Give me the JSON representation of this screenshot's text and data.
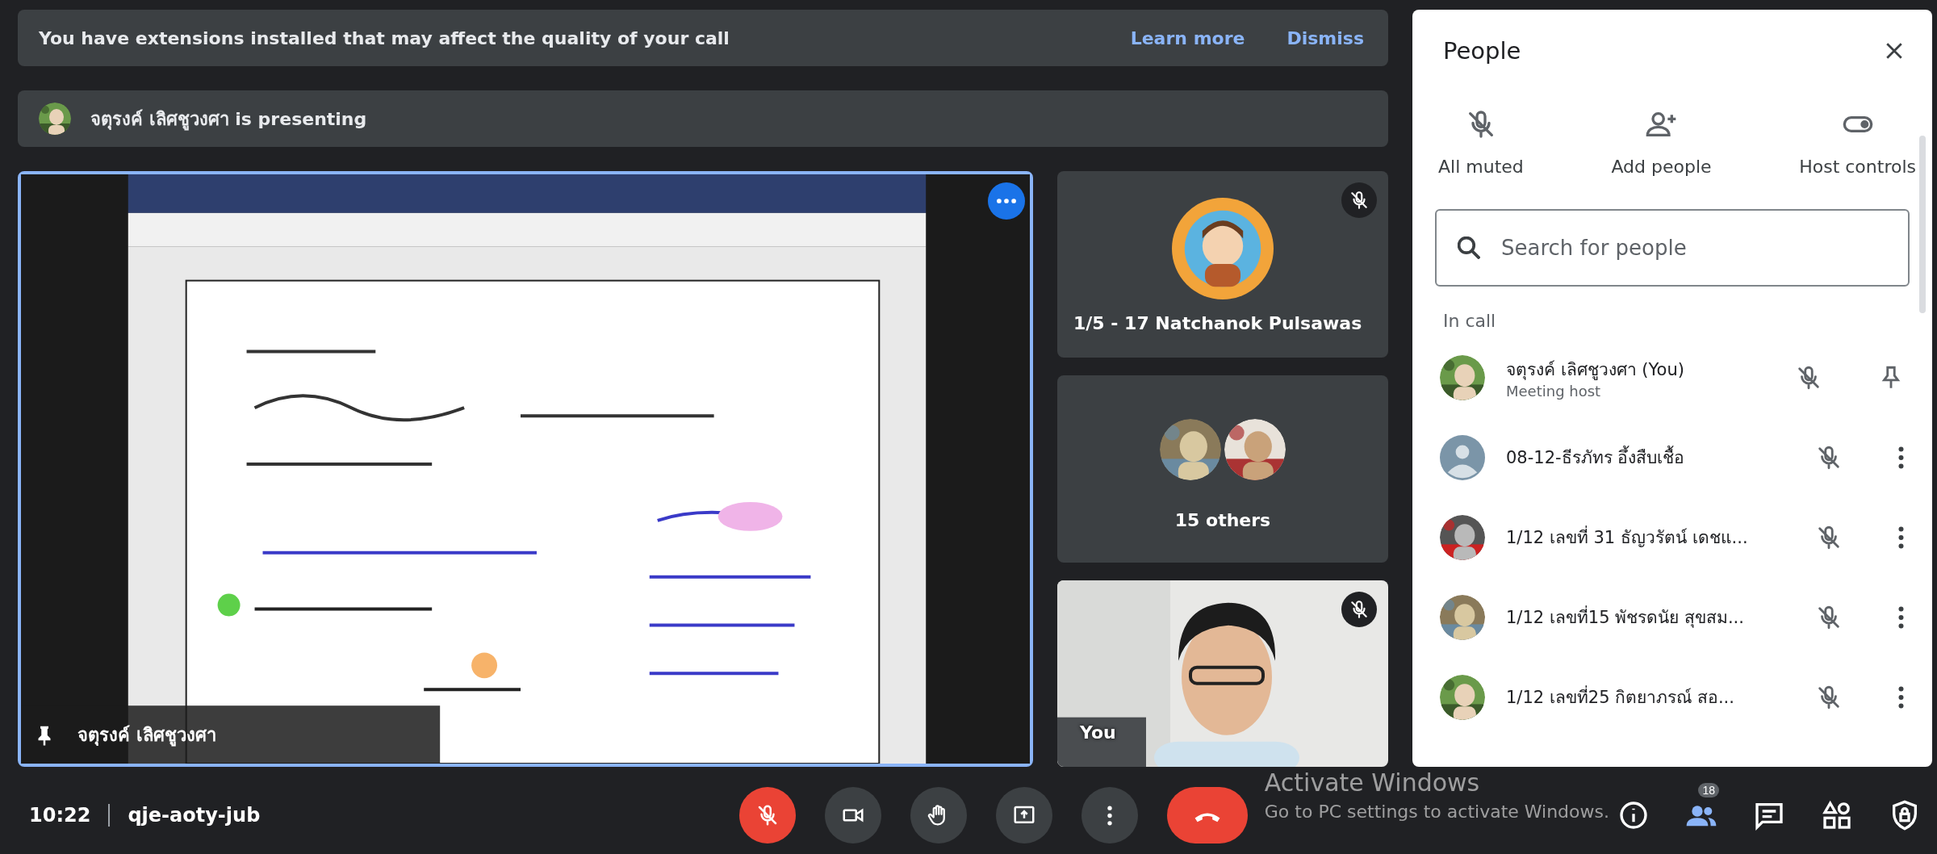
{
  "banners": [
    {
      "kind": "warning",
      "text": "You have extensions installed that may affect the quality of your call",
      "actions": [
        "Learn more",
        "Dismiss"
      ]
    },
    {
      "kind": "presenting",
      "text": "จตุรงค์ เลิศชูวงศา is presenting"
    }
  ],
  "presentation": {
    "kind": "picture",
    "presenter": "จตุรงค์ เลิศชูวงศา",
    "pinned": true
  },
  "tiles": [
    {
      "kind": "avatar",
      "name": "1/5 - 17 Natchanok Pulsawas",
      "muted": true
    },
    {
      "kind": "group",
      "name": "15 others",
      "muted": false
    },
    {
      "kind": "camera",
      "name": "You",
      "muted": true
    }
  ],
  "people_panel": {
    "title": "People",
    "actions": [
      {
        "kind": "mute",
        "label": "All muted"
      },
      {
        "kind": "add",
        "label": "Add people"
      },
      {
        "kind": "toggle",
        "label": "Host controls"
      }
    ],
    "search": {
      "placeholder": "Search for people"
    },
    "section": "In call",
    "participants": [
      {
        "name": "จตุรงค์ เลิศชูวงศา (You)",
        "role": "Meeting host",
        "muted": true,
        "action": {
          "kind": "pin"
        }
      },
      {
        "name": "08-12-ธีรภัทร อึ้งสืบเชื้อ",
        "avatar": {
          "kind": "default"
        },
        "muted": true,
        "action": {
          "kind": "more"
        }
      },
      {
        "name": "1/12 เลขที่ 31 ธัญวรัตน์ เดชแ...",
        "muted": true,
        "action": {
          "kind": "more"
        }
      },
      {
        "name": "1/12 เลขที่15 พัชรดนัย สุขสม...",
        "muted": true,
        "action": {
          "kind": "more"
        }
      },
      {
        "name": "1/12 เลขที่25 กิตยาภรณ์ สอ...",
        "muted": true,
        "action": {
          "kind": "more"
        }
      }
    ]
  },
  "bottom_bar": {
    "time": "10:22",
    "meeting_code": "qje-aoty-jub",
    "controls": [
      {
        "kind": "mic",
        "on": false
      },
      {
        "kind": "camera",
        "on": true
      },
      {
        "kind": "hand"
      },
      {
        "kind": "present"
      },
      {
        "kind": "more"
      },
      {
        "kind": "leave"
      }
    ],
    "right_icons": [
      {
        "kind": "info"
      },
      {
        "kind": "people",
        "badge": "18"
      },
      {
        "kind": "chat"
      },
      {
        "kind": "activities"
      },
      {
        "kind": "lock"
      }
    ]
  },
  "system_overlay": {
    "title": "Activate Windows",
    "subtitle": "Go to PC settings to activate Windows."
  }
}
